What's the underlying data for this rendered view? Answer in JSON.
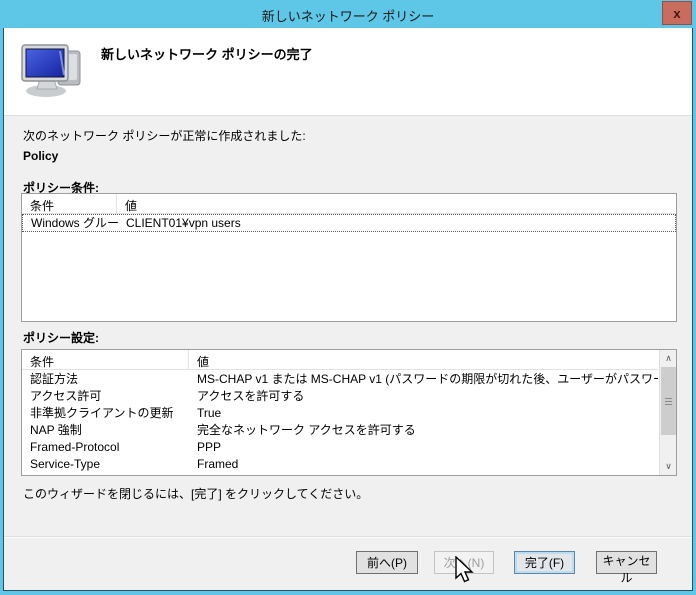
{
  "window": {
    "title": "新しいネットワーク ポリシー",
    "close_label": "x"
  },
  "header": {
    "title": "新しいネットワーク ポリシーの完了"
  },
  "body": {
    "intro": "次のネットワーク ポリシーが正常に作成されました:",
    "policy_name": "Policy",
    "conditions_label": "ポリシー条件:",
    "settings_label": "ポリシー設定:",
    "footer_note": "このウィザードを閉じるには、[完了] をクリックしてください。"
  },
  "conditions_table": {
    "headers": [
      "条件",
      "値"
    ],
    "rows": [
      {
        "condition": "Windows グループ",
        "value": "CLIENT01¥vpn users"
      }
    ]
  },
  "settings_table": {
    "headers": [
      "条件",
      "値"
    ],
    "rows": [
      {
        "condition": "認証方法",
        "value": "MS-CHAP v1 または MS-CHAP v1 (パスワードの期限が切れた後、ユーザーがパスワー..."
      },
      {
        "condition": "アクセス許可",
        "value": "アクセスを許可する"
      },
      {
        "condition": "非準拠クライアントの更新",
        "value": "True"
      },
      {
        "condition": "NAP 強制",
        "value": "完全なネットワーク アクセスを許可する"
      },
      {
        "condition": "Framed-Protocol",
        "value": "PPP"
      },
      {
        "condition": "Service-Type",
        "value": "Framed"
      }
    ]
  },
  "scrollbar": {
    "up": "∧",
    "down": "∨"
  },
  "buttons": {
    "back": "前へ(P)",
    "next": "次へ(N)",
    "finish": "完了(F)",
    "cancel": "キャンセル"
  },
  "colors": {
    "titlebar": "#5ec6e6",
    "close_button": "#c96c60",
    "header_bg": "#ffffff",
    "body_bg": "#f0f0f0",
    "table_border": "#9d9d9d",
    "screen_blue": "#2a41c8"
  }
}
